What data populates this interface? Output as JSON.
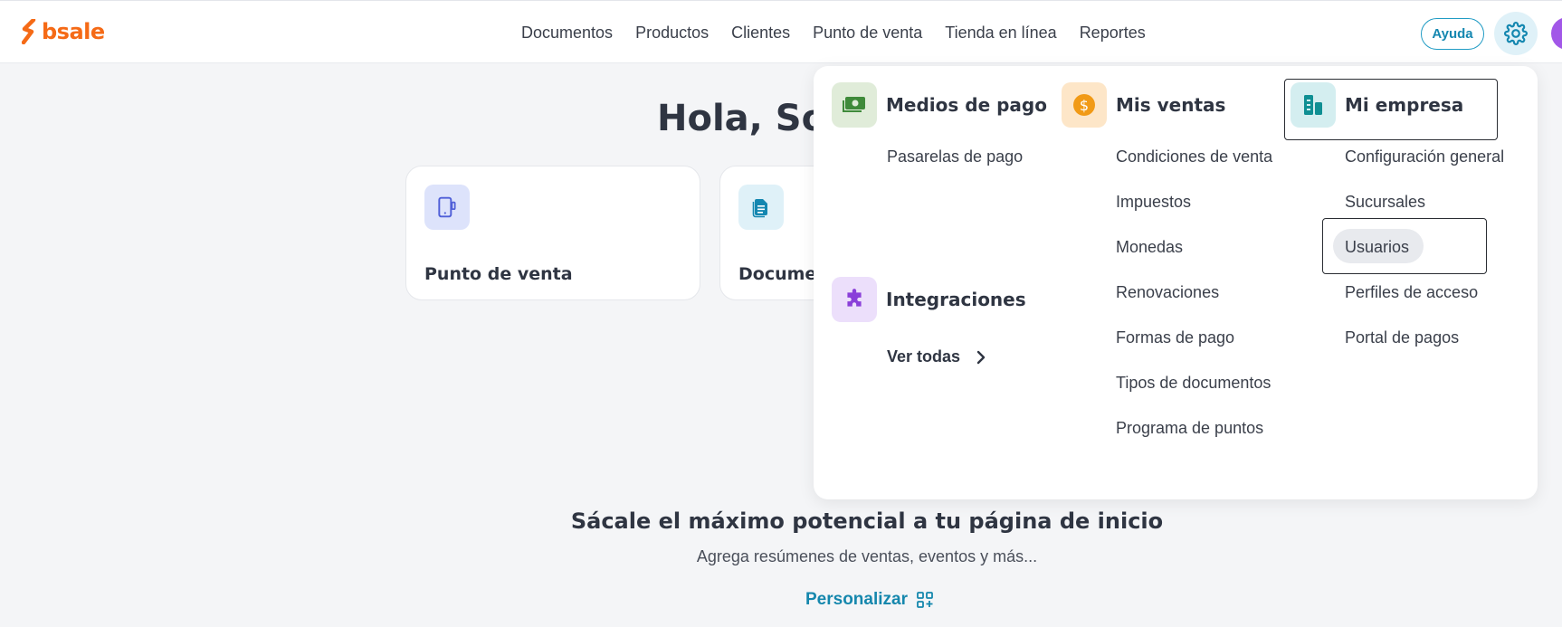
{
  "app": {
    "logo_text": "bsale"
  },
  "nav": {
    "items": [
      {
        "label": "Documentos"
      },
      {
        "label": "Productos"
      },
      {
        "label": "Clientes"
      },
      {
        "label": "Punto de venta"
      },
      {
        "label": "Tienda en línea"
      },
      {
        "label": "Reportes"
      }
    ],
    "help_label": "Ayuda"
  },
  "main": {
    "greeting": "Hola, Sop",
    "cards": [
      {
        "title": "Punto de venta"
      },
      {
        "title": "Docume"
      }
    ],
    "promo_title": "Sácale el máximo potencial a tu página de inicio",
    "promo_subtitle": "Agrega resúmenes de ventas, eventos y más...",
    "promo_link": "Personalizar"
  },
  "dropdown": {
    "medios_de_pago": {
      "title": "Medios de pago",
      "items": [
        "Pasarelas de pago"
      ]
    },
    "integraciones": {
      "title": "Integraciones",
      "link": "Ver todas"
    },
    "mis_ventas": {
      "title": "Mis ventas",
      "items": [
        "Condiciones de venta",
        "Impuestos",
        "Monedas",
        "Renovaciones",
        "Formas de pago",
        "Tipos de documentos",
        "Programa de puntos"
      ]
    },
    "mi_empresa": {
      "title": "Mi empresa",
      "items": [
        "Configuración general",
        "Sucursales",
        "Usuarios",
        "Perfiles de acceso",
        "Portal de pagos"
      ],
      "hovered_item": "Usuarios"
    }
  },
  "colors": {
    "brand": "#f56a16",
    "accent": "#1587ad",
    "medios_icon_bg": "#e0ecd9",
    "ventas_icon_bg": "#fde6c8",
    "empresa_icon_bg": "#d4eef0",
    "integraciones_icon_bg": "#ecdffb"
  },
  "icons": {
    "medios": "money-bill-icon",
    "ventas": "dollar-coin-icon",
    "empresa": "building-icon",
    "integraciones": "puzzle-icon",
    "settings": "gear-icon",
    "pos_card": "tablet-icon",
    "docs_card": "document-icon",
    "personalize": "widgets-add-icon"
  }
}
